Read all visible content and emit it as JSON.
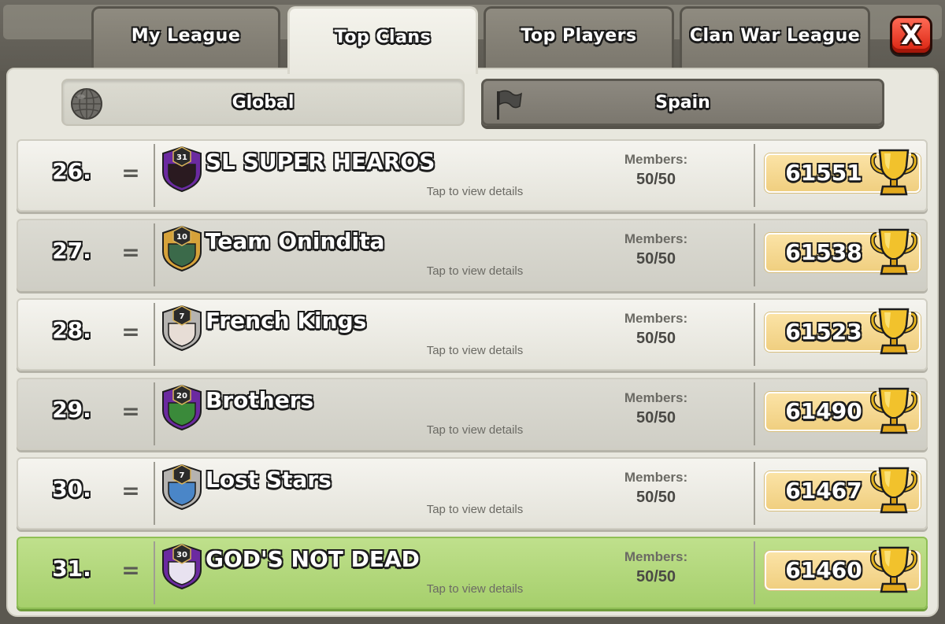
{
  "tabs": [
    {
      "label": "My League",
      "active": false
    },
    {
      "label": "Top Clans",
      "active": true
    },
    {
      "label": "Top Players",
      "active": false
    },
    {
      "label": "Clan War League",
      "active": false
    }
  ],
  "close_label": "X",
  "filters": {
    "global": {
      "label": "Global",
      "icon": "globe-icon",
      "selected": true
    },
    "local": {
      "label": "Spain",
      "icon": "flag-icon",
      "selected": false
    }
  },
  "tap_hint": "Tap to view details",
  "members_label": "Members:",
  "clans": [
    {
      "rank": "26.",
      "change": "=",
      "badge_level": "31",
      "name": "SL SUPER HEAROS",
      "members": "50/50",
      "trophies": "61551",
      "badge_colors": [
        "#6b2aa0",
        "#2a1a20"
      ],
      "highlight": false
    },
    {
      "rank": "27.",
      "change": "=",
      "badge_level": "10",
      "name": "Team Onindita",
      "members": "50/50",
      "trophies": "61538",
      "badge_colors": [
        "#d6a23a",
        "#3b6a4a"
      ],
      "highlight": false
    },
    {
      "rank": "28.",
      "change": "=",
      "badge_level": "7",
      "name": "French Kings",
      "members": "50/50",
      "trophies": "61523",
      "badge_colors": [
        "#b5b3b0",
        "#e7ddd6"
      ],
      "highlight": false
    },
    {
      "rank": "29.",
      "change": "=",
      "badge_level": "20",
      "name": "Brothers",
      "members": "50/50",
      "trophies": "61490",
      "badge_colors": [
        "#6b2aa0",
        "#3a8a3a"
      ],
      "highlight": false
    },
    {
      "rank": "30.",
      "change": "=",
      "badge_level": "7",
      "name": "Lost Stars",
      "members": "50/50",
      "trophies": "61467",
      "badge_colors": [
        "#b5b3b0",
        "#4a86c8"
      ],
      "highlight": false
    },
    {
      "rank": "31.",
      "change": "=",
      "badge_level": "30",
      "name": "GOD'S NOT DEAD",
      "members": "50/50",
      "trophies": "61460",
      "badge_colors": [
        "#6b2aa0",
        "#e8e2f0"
      ],
      "highlight": true
    }
  ]
}
